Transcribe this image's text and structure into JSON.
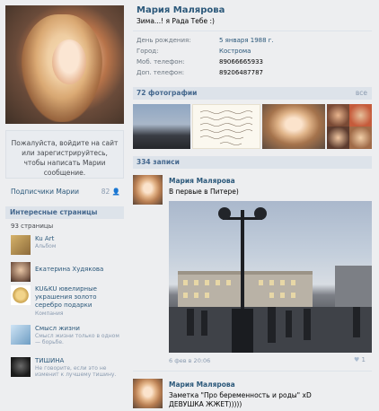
{
  "profile": {
    "name": "Мария Малярова",
    "status": "Зима...! я Рада Тебе :)",
    "info": [
      {
        "label": "День рождения:",
        "value": "5 января 1988 г.",
        "link": true
      },
      {
        "label": "Город:",
        "value": "Кострома",
        "link": true
      },
      {
        "label": "Моб. телефон:",
        "value": "89066665933",
        "link": false
      },
      {
        "label": "Доп. телефон:",
        "value": "89206487787",
        "link": false
      }
    ]
  },
  "left": {
    "login_prompt": "Пожалуйста, войдите на сайт или зарегистрируйтесь, чтобы написать Марии сообщение.",
    "subscribers_label": "Подписчики Марии",
    "subscribers_count": "82",
    "interesting_pages_title": "Интересные страницы",
    "pages_count": "93 страницы",
    "pages": [
      {
        "name": "Ku Art",
        "sub": "Альбом"
      },
      {
        "name": "Екатерина Худякова",
        "sub": ""
      },
      {
        "name": "KU&KU ювелирные украшения золото серебро подарки",
        "sub": "Компания"
      },
      {
        "name": "Смысл жизни",
        "sub": "Смысл жизни только в одном — борьбе."
      },
      {
        "name": "ТИШИНА",
        "sub": "Не говорите, если это не изменит к лучшему тишину."
      }
    ]
  },
  "photos": {
    "title": "72 фотографии",
    "all_label": "все"
  },
  "wall": {
    "title": "334 записи",
    "posts": [
      {
        "author": "Мария Малярова",
        "text": "В первые в Питере)",
        "date": "6 фев в 20:06",
        "likes": "1"
      },
      {
        "author": "Мария Малярова",
        "text_line1": "Заметка \"Про беременность и роды\" xD",
        "text_line2": "ДЕВУШКА ЖЖЕТ)))))"
      }
    ]
  },
  "colors": {
    "link": "#2b587a",
    "section_header_bg": "#dde3ea",
    "page_bg": "#edeef0"
  }
}
